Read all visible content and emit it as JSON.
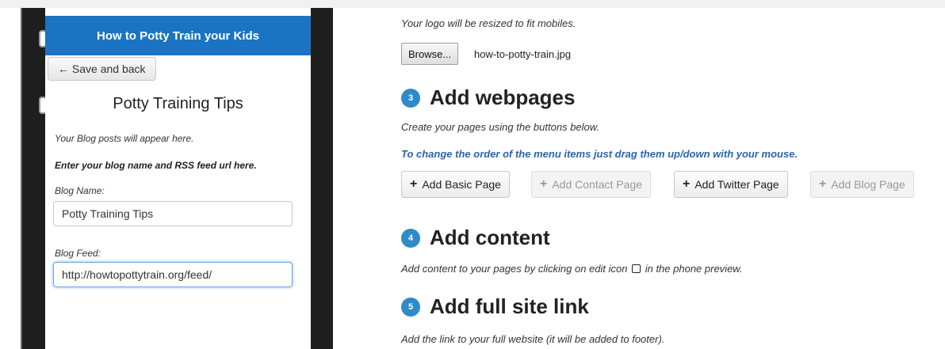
{
  "phone": {
    "header": "How to Potty Train your Kids",
    "save_back": "Save and back",
    "save_back_icon": "left-arrow-icon",
    "page_title": "Potty Training Tips",
    "blog_note": "Your Blog posts will appear here.",
    "instruction": "Enter your blog name and RSS feed url here.",
    "blog_name_label": "Blog Name:",
    "blog_name_value": "Potty Training Tips",
    "blog_feed_label": "Blog Feed:",
    "blog_feed_value": "http://howtopottytrain.org/feed/"
  },
  "logo_section": {
    "note": "Your logo will be resized to fit mobiles.",
    "browse_label": "Browse...",
    "file_name": "how-to-potty-train.jpg"
  },
  "webpages_section": {
    "step": "3",
    "title": "Add webpages",
    "note": "Create your pages using the buttons below.",
    "order_note": "To change the order of the menu items just drag them up/down with your mouse.",
    "buttons": [
      {
        "label": "Add Basic Page",
        "enabled": true
      },
      {
        "label": "Add Contact Page",
        "enabled": false
      },
      {
        "label": "Add Twitter Page",
        "enabled": true
      },
      {
        "label": "Add Blog Page",
        "enabled": false
      }
    ]
  },
  "content_section": {
    "step": "4",
    "title": "Add content",
    "note_before": "Add content to your pages by clicking on edit icon",
    "note_after": "in the phone preview."
  },
  "site_link_section": {
    "step": "5",
    "title": "Add full site link",
    "note": "Add the link to your full website (it will be added to footer)."
  },
  "colors": {
    "phone_header": "#1a74c3",
    "step_badge": "#2e8bc9",
    "blue_note": "#2a64b0"
  }
}
